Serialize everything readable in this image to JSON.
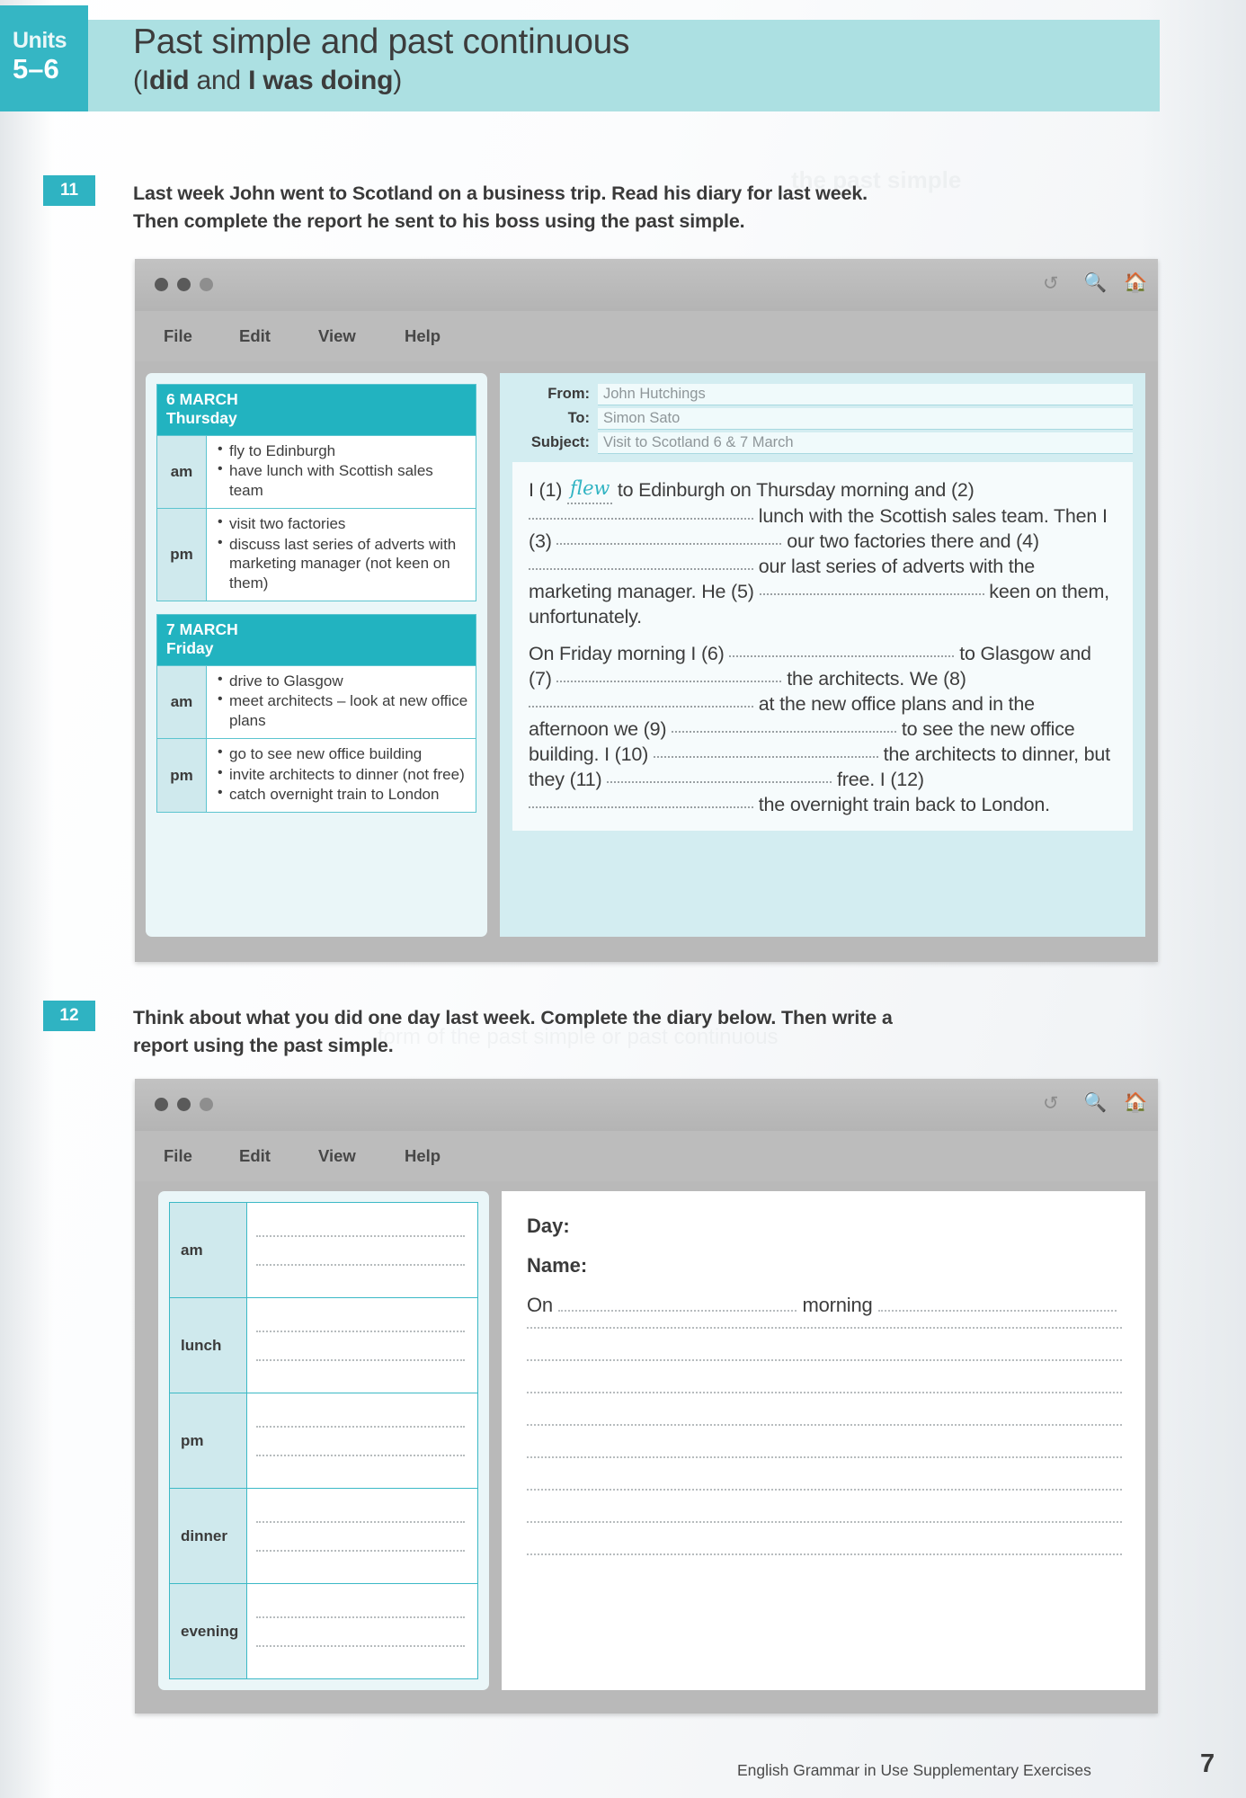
{
  "header": {
    "units_word": "Units",
    "units_range": "5–6",
    "title": "Past simple and past continuous",
    "subtitle_open": "(",
    "subtitle_i1": "I",
    "subtitle_b1": "did",
    "subtitle_and": " and ",
    "subtitle_b2": "I was doing",
    "subtitle_close": ")"
  },
  "exercise11": {
    "number": "11",
    "instruction_line1": "Last week John went to Scotland on a business trip.  Read his diary for last week.",
    "instruction_line2": "Then complete the report he sent to his boss using the past simple.",
    "window": {
      "menu": [
        "File",
        "Edit",
        "View",
        "Help"
      ],
      "icons": [
        "refresh-icon",
        "search-icon",
        "home-icon"
      ]
    },
    "diary": [
      {
        "date": "6 MARCH",
        "day": "Thursday",
        "rows": [
          {
            "label": "am",
            "items": [
              "fly to Edinburgh",
              "have lunch with Scottish sales team"
            ]
          },
          {
            "label": "pm",
            "items": [
              "visit two factories",
              "discuss last series of adverts with marketing manager (not keen on them)"
            ]
          }
        ]
      },
      {
        "date": "7 MARCH",
        "day": "Friday",
        "rows": [
          {
            "label": "am",
            "items": [
              "drive to Glasgow",
              "meet architects – look at new office plans"
            ]
          },
          {
            "label": "pm",
            "items": [
              "go to see new office building",
              "invite architects to dinner (not free)",
              "catch overnight train to London"
            ]
          }
        ]
      }
    ],
    "email": {
      "from_label": "From:",
      "from_value": "John Hutchings",
      "to_label": "To:",
      "to_value": "Simon Sato",
      "subject_label": "Subject:",
      "subject_value": "Visit to Scotland 6 & 7 March",
      "answer_1": "flew",
      "paragraph1": [
        {
          "t": "I (1) "
        },
        {
          "answer": "flew"
        },
        {
          "t": " to Edinburgh on Thursday morning and (2) "
        },
        {
          "gap": 250
        },
        {
          "t": " lunch with the Scottish sales team. Then I (3) "
        },
        {
          "gap": 250
        },
        {
          "t": " our two factories there and (4) "
        },
        {
          "gap": 250
        },
        {
          "t": " our last series of adverts with the marketing manager.  He (5) "
        },
        {
          "gap": 250
        },
        {
          "t": " keen on them, unfortunately."
        }
      ],
      "paragraph2": [
        {
          "t": "On Friday morning I (6) "
        },
        {
          "gap": 250
        },
        {
          "t": " to Glasgow and (7) "
        },
        {
          "gap": 250
        },
        {
          "t": " the architects.  We (8) "
        },
        {
          "gap": 250
        },
        {
          "t": " at the new office plans and in the afternoon we (9) "
        },
        {
          "gap": 250
        },
        {
          "t": " to see the new office building.  I (10) "
        },
        {
          "gap": 250
        },
        {
          "t": " the architects to dinner, but they (11) "
        },
        {
          "gap": 250
        },
        {
          "t": " free. I (12) "
        },
        {
          "gap": 250
        },
        {
          "t": " the overnight train back to London."
        }
      ]
    }
  },
  "exercise12": {
    "number": "12",
    "instruction_line1": "Think about what you did one day last week.  Complete the diary below.  Then write a",
    "instruction_line2": "report using the past simple.",
    "window": {
      "menu": [
        "File",
        "Edit",
        "View",
        "Help"
      ],
      "icons": [
        "refresh-icon",
        "search-icon",
        "home-icon"
      ]
    },
    "diary_labels": [
      "am",
      "lunch",
      "pm",
      "dinner",
      "evening"
    ],
    "report": {
      "day_label": "Day:",
      "name_label": "Name:",
      "on_word": "On",
      "morning_word": "morning",
      "blank_line_count": 8
    }
  },
  "footer": {
    "text": "English Grammar in Use Supplementary Exercises",
    "page": "7"
  }
}
